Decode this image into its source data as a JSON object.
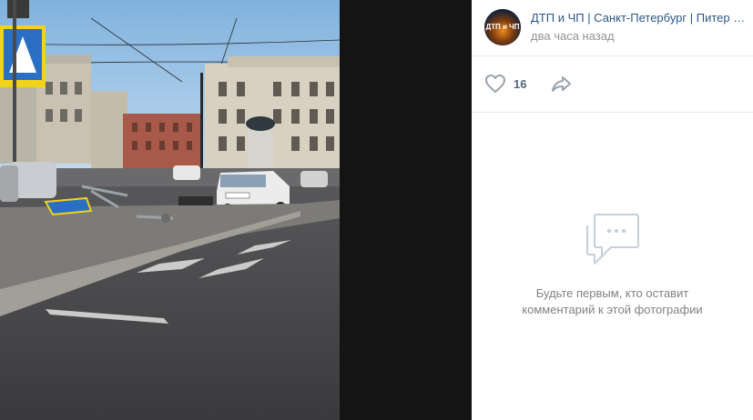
{
  "post": {
    "author": "ДТП и ЧП | Санкт-Петербург | Питер Онлайн | СПб",
    "time": "два часа назад",
    "avatar_text": "ДТП и ЧП"
  },
  "actions": {
    "likes": "16"
  },
  "comments": {
    "empty_text": "Будьте первым, кто оставит\nкомментарий к этой фотографии"
  },
  "colors": {
    "link": "#2a5885",
    "muted": "#939393",
    "icon": "#99a2ad"
  }
}
